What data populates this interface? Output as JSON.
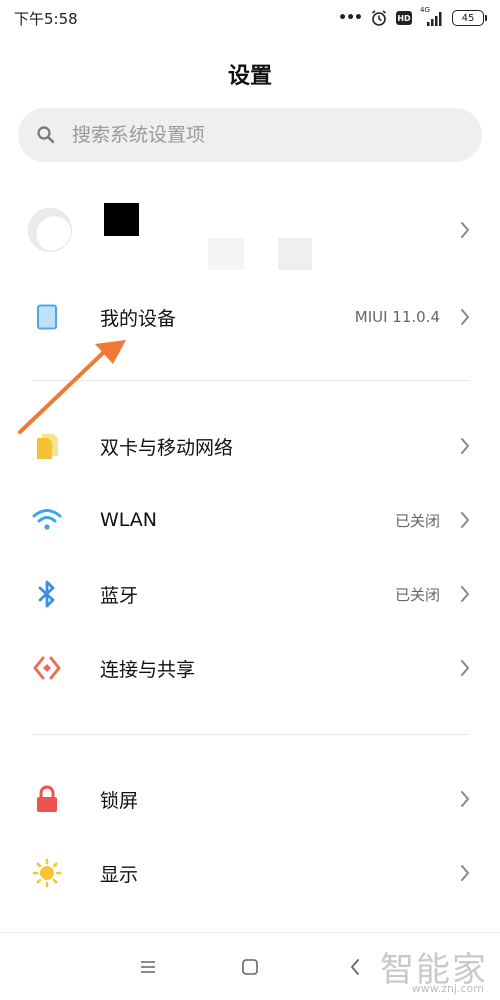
{
  "status_bar": {
    "time": "下午5:58",
    "dots": "•••",
    "hd": "HD",
    "network": "4G",
    "battery": "45"
  },
  "header": {
    "title": "设置"
  },
  "search": {
    "placeholder": "搜索系统设置项"
  },
  "account": {},
  "items": [
    {
      "label": "我的设备",
      "value": "MIUI 11.0.4",
      "icon": "tablet-icon",
      "color": "#4ea8e8"
    },
    {
      "label": "双卡与移动网络",
      "value": "",
      "icon": "sim-card-icon",
      "color": "#f6c234"
    },
    {
      "label": "WLAN",
      "value": "已关闭",
      "icon": "wifi-icon",
      "color": "#3aa6f0"
    },
    {
      "label": "蓝牙",
      "value": "已关闭",
      "icon": "bluetooth-icon",
      "color": "#3b8fe6"
    },
    {
      "label": "连接与共享",
      "value": "",
      "icon": "share-connection-icon",
      "color": "#ea6f52"
    },
    {
      "label": "锁屏",
      "value": "",
      "icon": "lock-icon",
      "color": "#ef5350"
    },
    {
      "label": "显示",
      "value": "",
      "icon": "sun-icon",
      "color": "#f7c531"
    }
  ],
  "watermark": {
    "text": "智能家",
    "sub": "www.znj.com"
  },
  "annotation": {
    "arrow_color": "#f07a35"
  }
}
